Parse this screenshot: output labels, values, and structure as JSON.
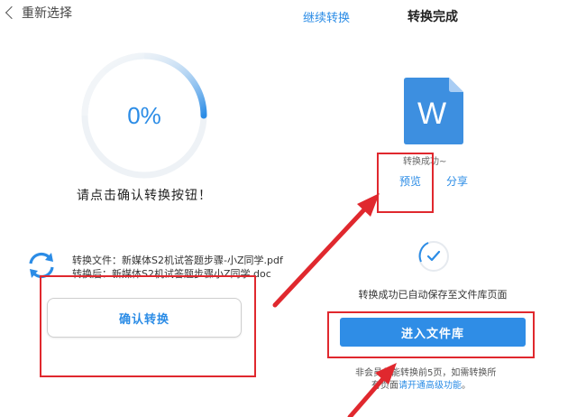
{
  "left_panel": {
    "back_label": "重新选择",
    "progress_value": 0.0,
    "progress_text": "0%",
    "hint": "请点击确认转换按钮！",
    "source_file_line": "转换文件：新媒体S2机试答题步骤-小Z同学.pdf",
    "target_file_line": "转换后：新媒体S2机试答题步骤小Z同学.doc",
    "confirm_label": "确认转换"
  },
  "right_panel": {
    "continue_label": "继续转换",
    "title": "转换完成",
    "doc_letter": "W",
    "success_text": "转换成功~",
    "preview_label": "预览",
    "share_label": "分享",
    "saved_text": "转换成功已自动保存至文件库页面",
    "library_label": "进入文件库",
    "note_line1": "非会员仅能转换前5页，如需转换所",
    "note_line2_prefix": "有页面",
    "note_line2_link": "请开通高级功能",
    "note_line2_suffix": "。"
  },
  "colors": {
    "accent": "#2b8ce6",
    "annotation": "#e0282e",
    "doc_icon": "#3d8fe0"
  }
}
